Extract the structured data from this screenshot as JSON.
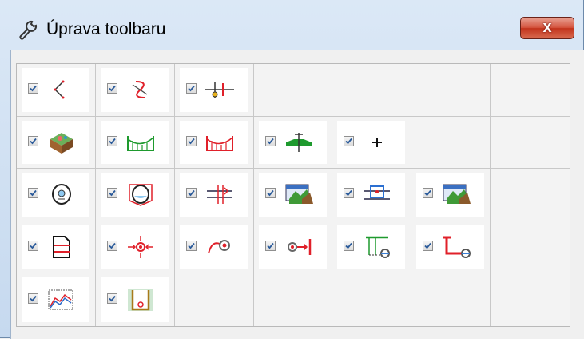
{
  "window": {
    "title": "Úprava toolbaru",
    "title_icon": "wrench-icon",
    "close_glyph": "x"
  },
  "colors": {
    "accent_red": "#e0202a",
    "accent_green": "#1e9a2e",
    "checkbox_check": "#2a5a9a"
  },
  "toolbar_items": [
    [
      {
        "checked": true,
        "icon": "curve-angle-icon"
      },
      {
        "checked": true,
        "icon": "route-curve-icon"
      },
      {
        "checked": true,
        "icon": "profile-marker-icon"
      },
      null,
      null,
      null,
      null
    ],
    [
      {
        "checked": true,
        "icon": "terrain-3d-icon"
      },
      {
        "checked": true,
        "icon": "green-profile-icon"
      },
      {
        "checked": true,
        "icon": "red-profile-icon"
      },
      {
        "checked": true,
        "icon": "green-section-icon"
      },
      {
        "checked": true,
        "icon": "crosshair-icon"
      },
      null,
      null
    ],
    [
      {
        "checked": true,
        "icon": "manhole-icon"
      },
      {
        "checked": true,
        "icon": "manhole-section-icon"
      },
      {
        "checked": true,
        "icon": "pipe-crossing-icon"
      },
      {
        "checked": true,
        "icon": "terrain-map-icon"
      },
      {
        "checked": true,
        "icon": "pipe-bridge-icon"
      },
      {
        "checked": true,
        "icon": "terrain-map-icon"
      },
      null
    ],
    [
      {
        "checked": true,
        "icon": "document-red-icon"
      },
      {
        "checked": true,
        "icon": "node-arrows-icon"
      },
      {
        "checked": true,
        "icon": "curve-node-icon"
      },
      {
        "checked": true,
        "icon": "node-end-icon"
      },
      {
        "checked": true,
        "icon": "pipe-connection-icon"
      },
      {
        "checked": true,
        "icon": "connection-red-icon"
      },
      null
    ],
    [
      {
        "checked": true,
        "icon": "chart-area-icon"
      },
      {
        "checked": true,
        "icon": "shaft-section-icon"
      },
      null,
      null,
      null,
      null,
      null
    ]
  ]
}
